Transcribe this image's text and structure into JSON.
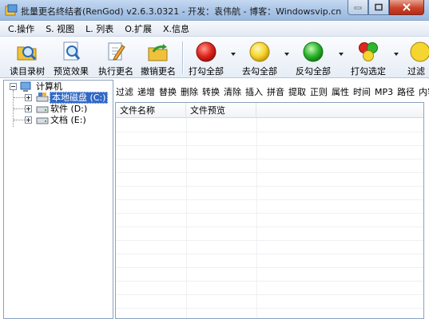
{
  "window": {
    "title": "批量更名终结者(RenGod) v2.6.3.0321 - 开发：袁伟航 - 博客：Windowsvip.cn"
  },
  "menu": [
    {
      "label": "C.操作"
    },
    {
      "label": "S. 视图"
    },
    {
      "label": "L. 列表"
    },
    {
      "label": "O.扩展"
    },
    {
      "label": "X.信息"
    }
  ],
  "toolbar": {
    "read_dir": "读目录树",
    "preview": "预览效果",
    "execute": "执行更名",
    "undo": "撤销更名",
    "check_all": "打勾全部",
    "uncheck_all": "去勾全部",
    "invert": "反勾全部",
    "check_selected": "打勾选定",
    "filter": "过滤"
  },
  "tree": {
    "root": "计算机",
    "drives": [
      {
        "label": "本地磁盘 (C:)"
      },
      {
        "label": "软件 (D:)"
      },
      {
        "label": "文档 (E:)"
      }
    ]
  },
  "tabs": [
    "过滤",
    "递增",
    "替换",
    "删除",
    "转换",
    "清除",
    "插入",
    "拼音",
    "提取",
    "正则",
    "属性",
    "时间",
    "MP3",
    "路径",
    "内容"
  ],
  "list": {
    "columns": [
      "文件名称",
      "文件预览"
    ]
  },
  "colors": {
    "red": "#e0261f",
    "yellow": "#f5d630",
    "green": "#2fb52f",
    "selection": "#3169c6"
  }
}
